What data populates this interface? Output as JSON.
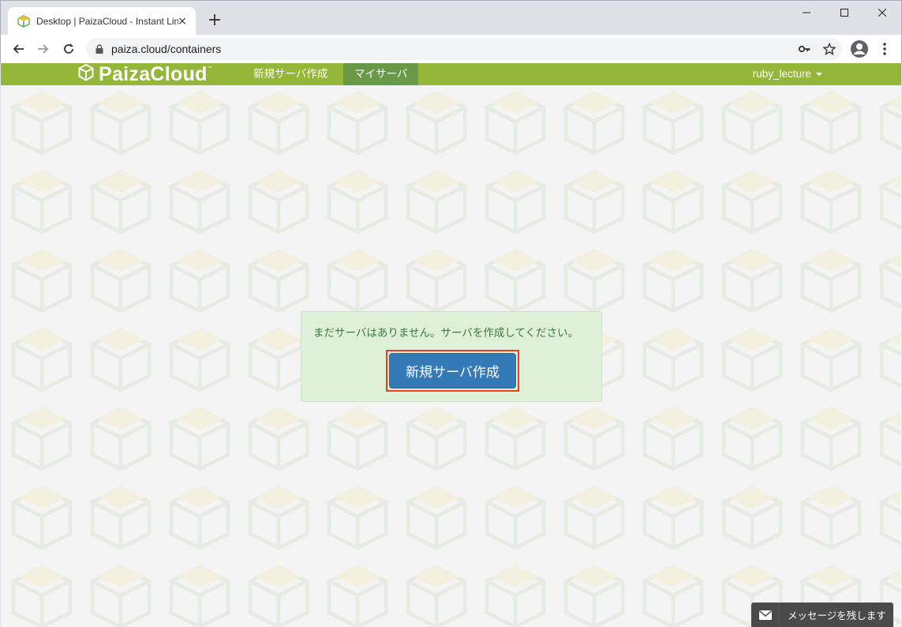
{
  "browser": {
    "tab_title": "Desktop | PaizaCloud - Instant Linux Cloud",
    "tab_close": "×",
    "new_tab": "+",
    "url": "paiza.cloud/containers"
  },
  "navbar": {
    "brand": "PaizaCloud",
    "brand_tm": "™",
    "items": [
      {
        "label": "新規サーバ作成"
      },
      {
        "label": "マイサーバ"
      }
    ],
    "user": "ruby_lecture"
  },
  "main": {
    "notice": "まだサーバはありません。サーバを作成してください。",
    "create_button": "新規サーバ作成"
  },
  "message": {
    "label": "メッセージを残します"
  },
  "colors": {
    "navbar": "#94b739",
    "nav_active": "#6a9a48",
    "alert_bg": "#dff0d8",
    "alert_text": "#3c763d",
    "button": "#337ab7",
    "highlight": "#e8401c"
  },
  "icons": [
    "paizacloud-favicon",
    "close-icon",
    "plus-icon",
    "minimize-icon",
    "maximize-icon",
    "window-close-icon",
    "back-arrow-icon",
    "forward-arrow-icon",
    "reload-icon",
    "lock-icon",
    "key-icon",
    "star-icon",
    "profile-icon",
    "menu-dots-icon",
    "paizacloud-logo-icon",
    "envelope-icon"
  ]
}
